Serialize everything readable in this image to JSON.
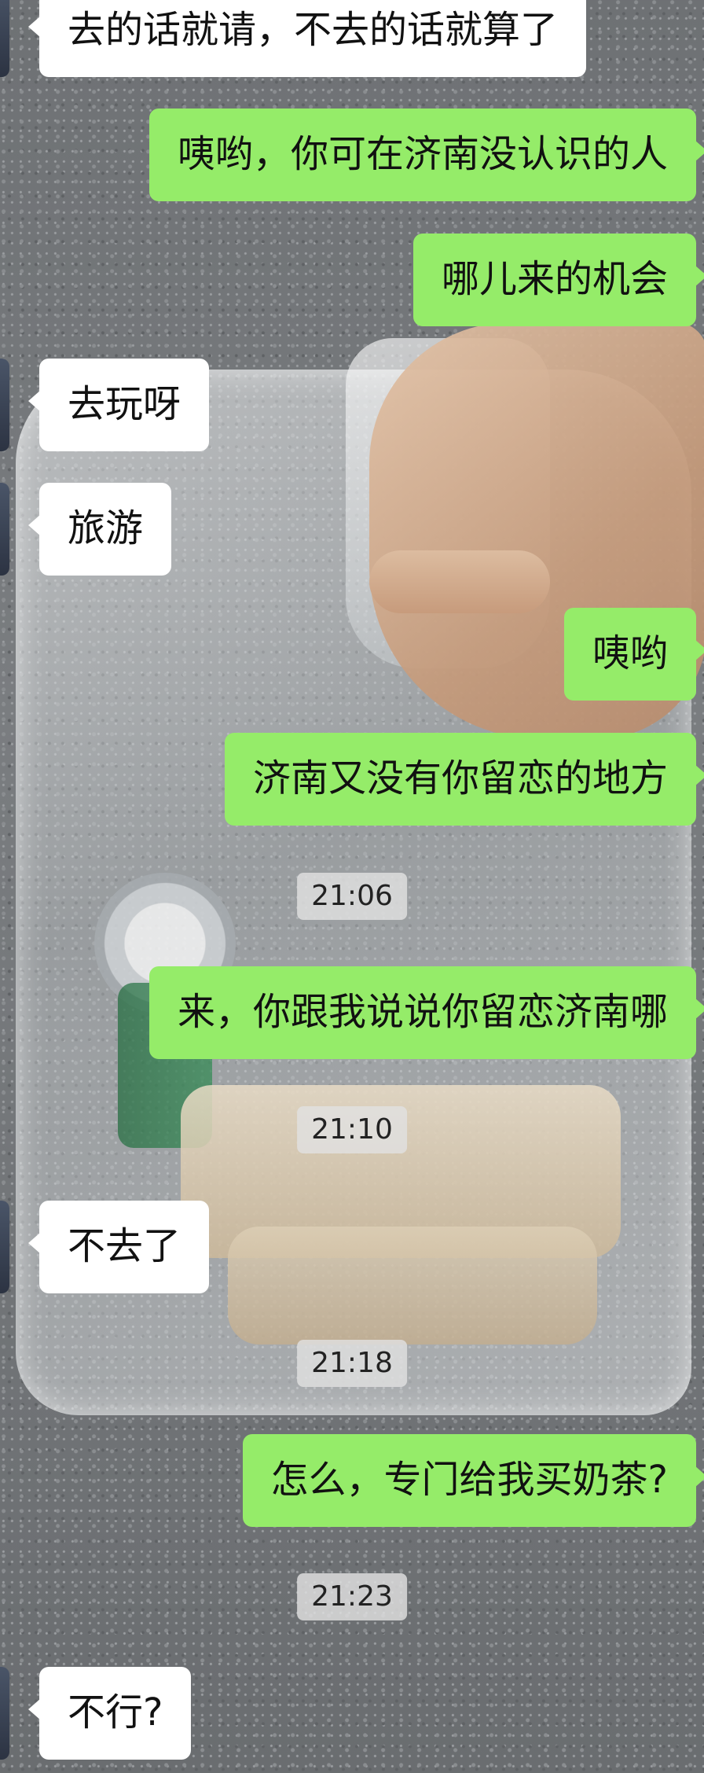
{
  "messages": [
    {
      "side": "in",
      "text": "去的话就请，不去的话就算了"
    },
    {
      "side": "out",
      "text": "咦哟，你可在济南没认识的人"
    },
    {
      "side": "out",
      "text": "哪儿来的机会"
    },
    {
      "side": "in",
      "text": "去玩呀"
    },
    {
      "side": "in",
      "text": "旅游"
    },
    {
      "side": "out",
      "text": "咦哟"
    },
    {
      "side": "out",
      "text": "济南又没有你留恋的地方"
    },
    {
      "side": "time",
      "text": "21:06"
    },
    {
      "side": "out",
      "text": "来，你跟我说说你留恋济南哪"
    },
    {
      "side": "time",
      "text": "21:10"
    },
    {
      "side": "in",
      "text": "不去了"
    },
    {
      "side": "time",
      "text": "21:18"
    },
    {
      "side": "out",
      "text": "怎么，专门给我买奶茶?"
    },
    {
      "side": "time",
      "text": "21:23"
    },
    {
      "side": "in",
      "text": "不行?"
    }
  ],
  "colors": {
    "incoming_bubble": "#ffffff",
    "outgoing_bubble": "#95ec69",
    "timestamp_bg": "#e1e1e1",
    "text": "#111111"
  }
}
